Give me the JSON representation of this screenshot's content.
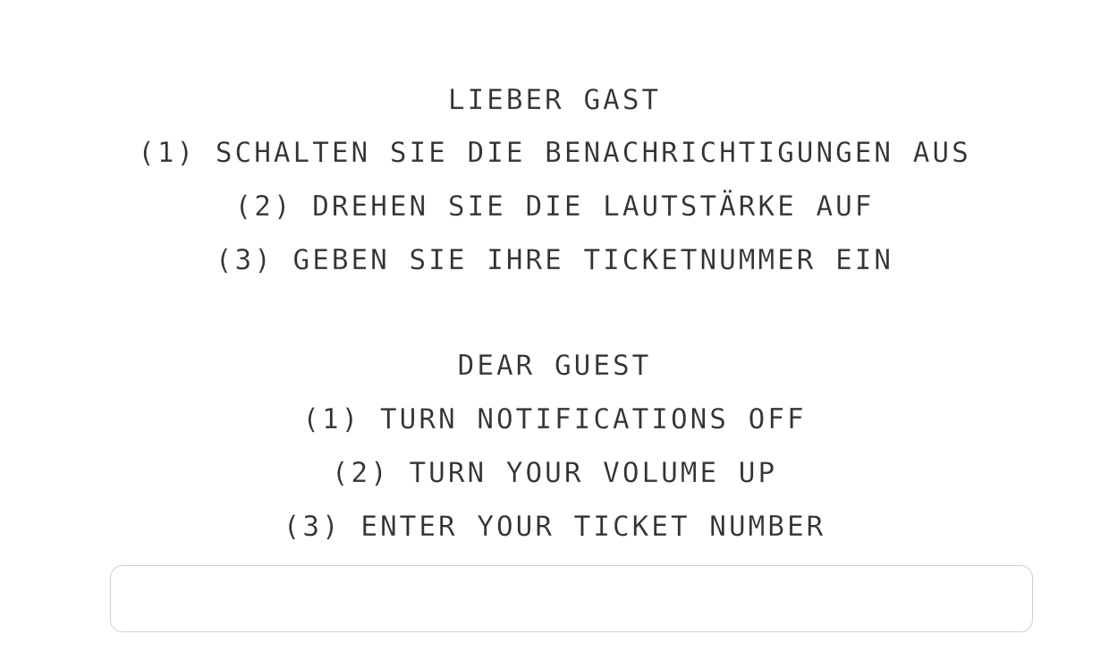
{
  "german": {
    "heading": "LIEBER GAST",
    "steps": [
      "(1) SCHALTEN SIE DIE BENACHRICHTIGUNGEN AUS",
      "(2) DREHEN SIE DIE LAUTSTÄRKE AUF",
      "(3) GEBEN SIE IHRE TICKETNUMMER EIN"
    ]
  },
  "english": {
    "heading": "DEAR GUEST",
    "steps": [
      "(1) TURN NOTIFICATIONS OFF",
      "(2) TURN YOUR VOLUME UP",
      "(3) ENTER YOUR TICKET NUMBER"
    ]
  },
  "ticket_input": {
    "value": "",
    "placeholder": ""
  }
}
